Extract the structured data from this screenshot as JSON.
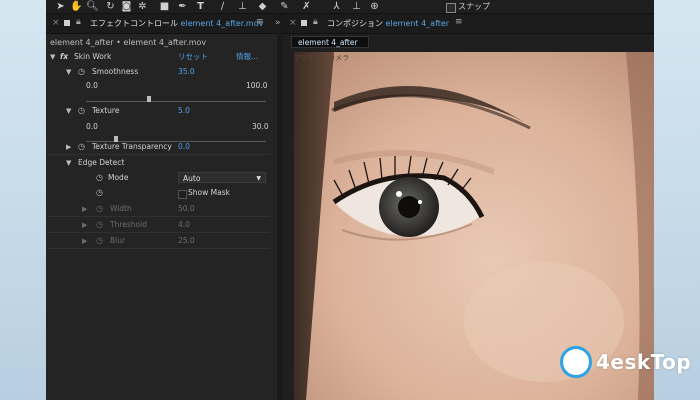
{
  "toolbar": {
    "icons": [
      "selection-tool",
      "hand-tool",
      "zoom-tool",
      "rotate-tool",
      "camera-tool",
      "pan-behind-tool",
      "rectangle-tool",
      "pen-tool",
      "type-tool",
      "brush-tool",
      "clone-tool",
      "eraser-tool",
      "roto-brush-tool",
      "puppet-tool"
    ],
    "snap_label": "スナップ"
  },
  "effect_controls": {
    "tab_title": "エフェクトコントロール",
    "tab_file": "element 4_after.mov",
    "breadcrumb": "element 4_after • element 4_after.mov",
    "effect_name": "Skin Work",
    "reset_label": "リセット",
    "info_label": "情報...",
    "fx_label": "fx",
    "params": {
      "smoothness": {
        "label": "Smoothness",
        "value": "35.0",
        "min": "0.0",
        "max": "100.0",
        "level": 0.35
      },
      "texture": {
        "label": "Texture",
        "value": "5.0",
        "min": "0.0",
        "max": "30.0",
        "level": 0.167
      },
      "texture_transparency": {
        "label": "Texture Transparency",
        "value": "0.0"
      },
      "edge_detect": {
        "label": "Edge Detect"
      },
      "mode": {
        "label": "Mode",
        "value": "Auto"
      },
      "show_mask": {
        "label": "Show Mask"
      },
      "width": {
        "label": "Width",
        "value": "50.0"
      },
      "threshold": {
        "label": "Threshold",
        "value": "4.0"
      },
      "blur": {
        "label": "Blur",
        "value": "25.0"
      }
    }
  },
  "composition": {
    "tab_title": "コンポジション",
    "tab_name": "element 4_after",
    "sub_tab": "element 4_after",
    "view_label": "アクティブカメラ"
  },
  "watermark": {
    "text": "4eskTop"
  }
}
